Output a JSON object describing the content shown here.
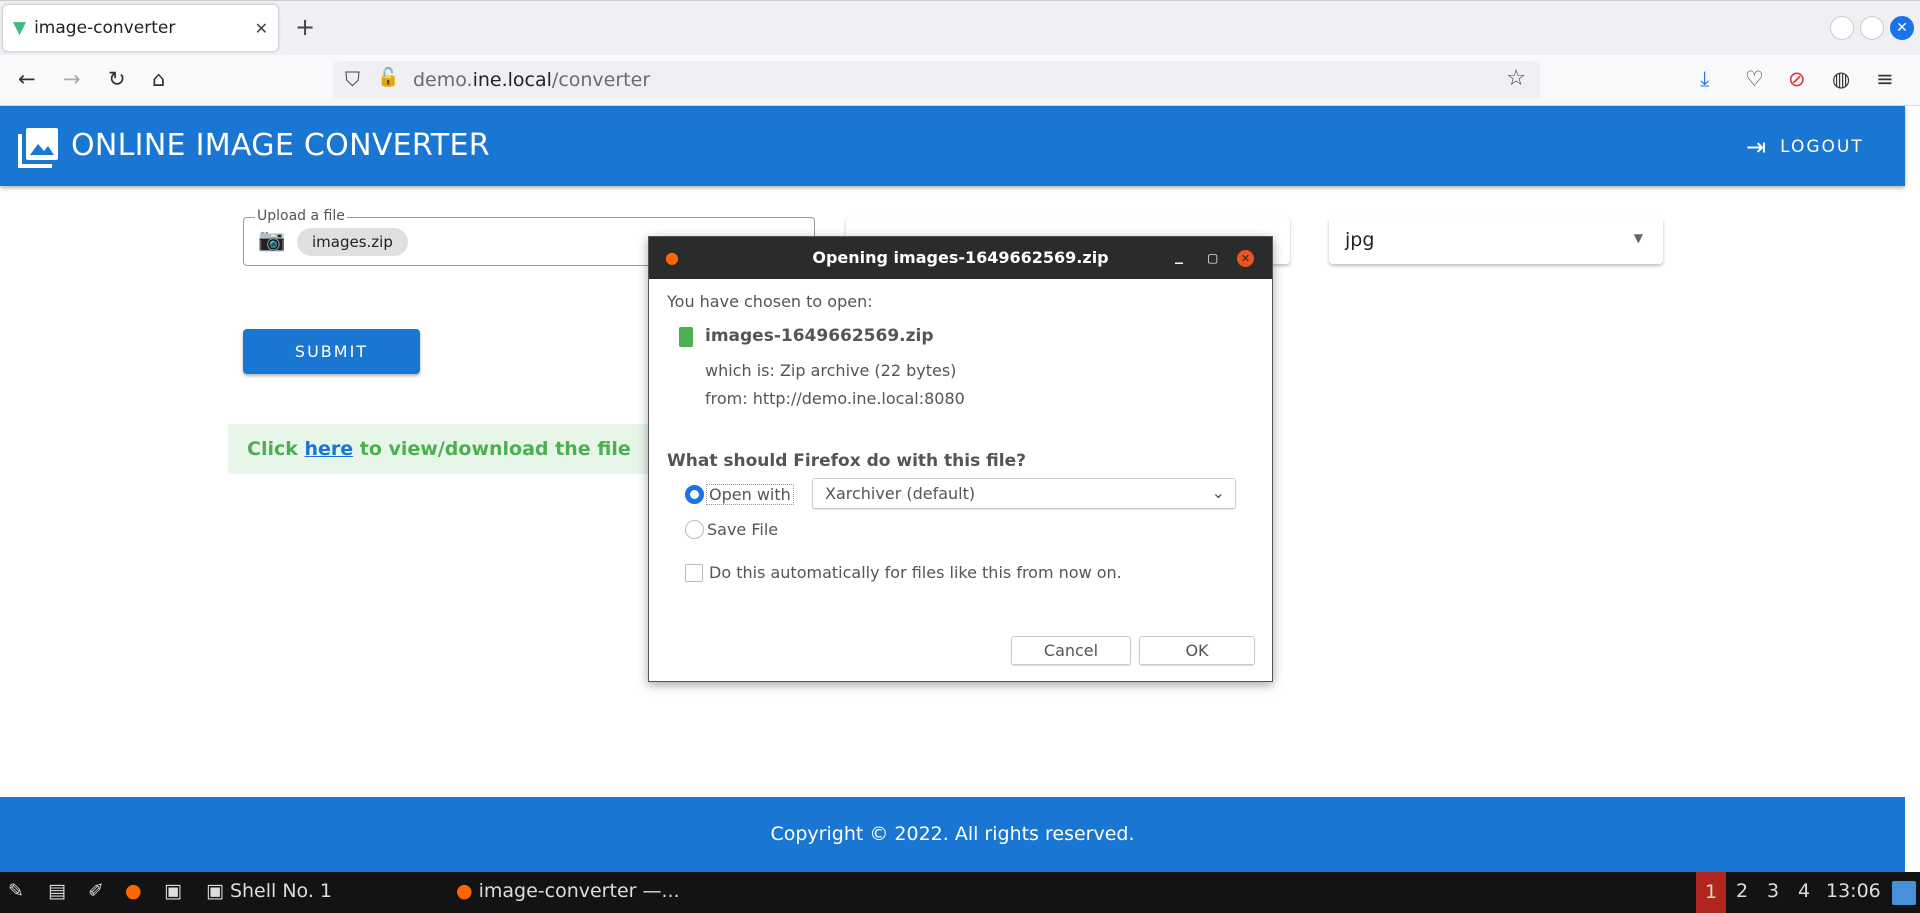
{
  "browser": {
    "tab_title": "image-converter",
    "url_domain_prefix": "demo.",
    "url_domain": "ine.local",
    "url_path": "/converter"
  },
  "app": {
    "title": "ONLINE IMAGE CONVERTER",
    "logout_label": "LOGOUT",
    "accent": "#1976d2"
  },
  "form": {
    "upload_label": "Upload a file",
    "upload_value": "images.zip",
    "format_value": "jpg",
    "submit_label": "SUBMIT"
  },
  "alert": {
    "prefix": "Click ",
    "link": "here",
    "suffix": " to view/download the file"
  },
  "footer": {
    "text": "Copyright © 2022. All rights reserved."
  },
  "dialog": {
    "title": "Opening images-1649662569.zip",
    "intro": "You have chosen to open:",
    "filename": "images-1649662569.zip",
    "which_is": "which is: Zip archive (22 bytes)",
    "from": "from: http://demo.ine.local:8080",
    "question": "What should Firefox do with this file?",
    "open_with_label": "Open with",
    "open_with_app": "Xarchiver (default)",
    "save_file_label": "Save File",
    "auto_label": "Do this automatically for files like this from now on.",
    "cancel_label": "Cancel",
    "ok_label": "OK",
    "selected_option": "open_with"
  },
  "taskbar": {
    "shell_label": "Shell No. 1",
    "firefox_label": "image-converter —...",
    "workspaces": [
      "1",
      "2",
      "3",
      "4"
    ],
    "active_workspace": "1",
    "clock": "13:06"
  }
}
